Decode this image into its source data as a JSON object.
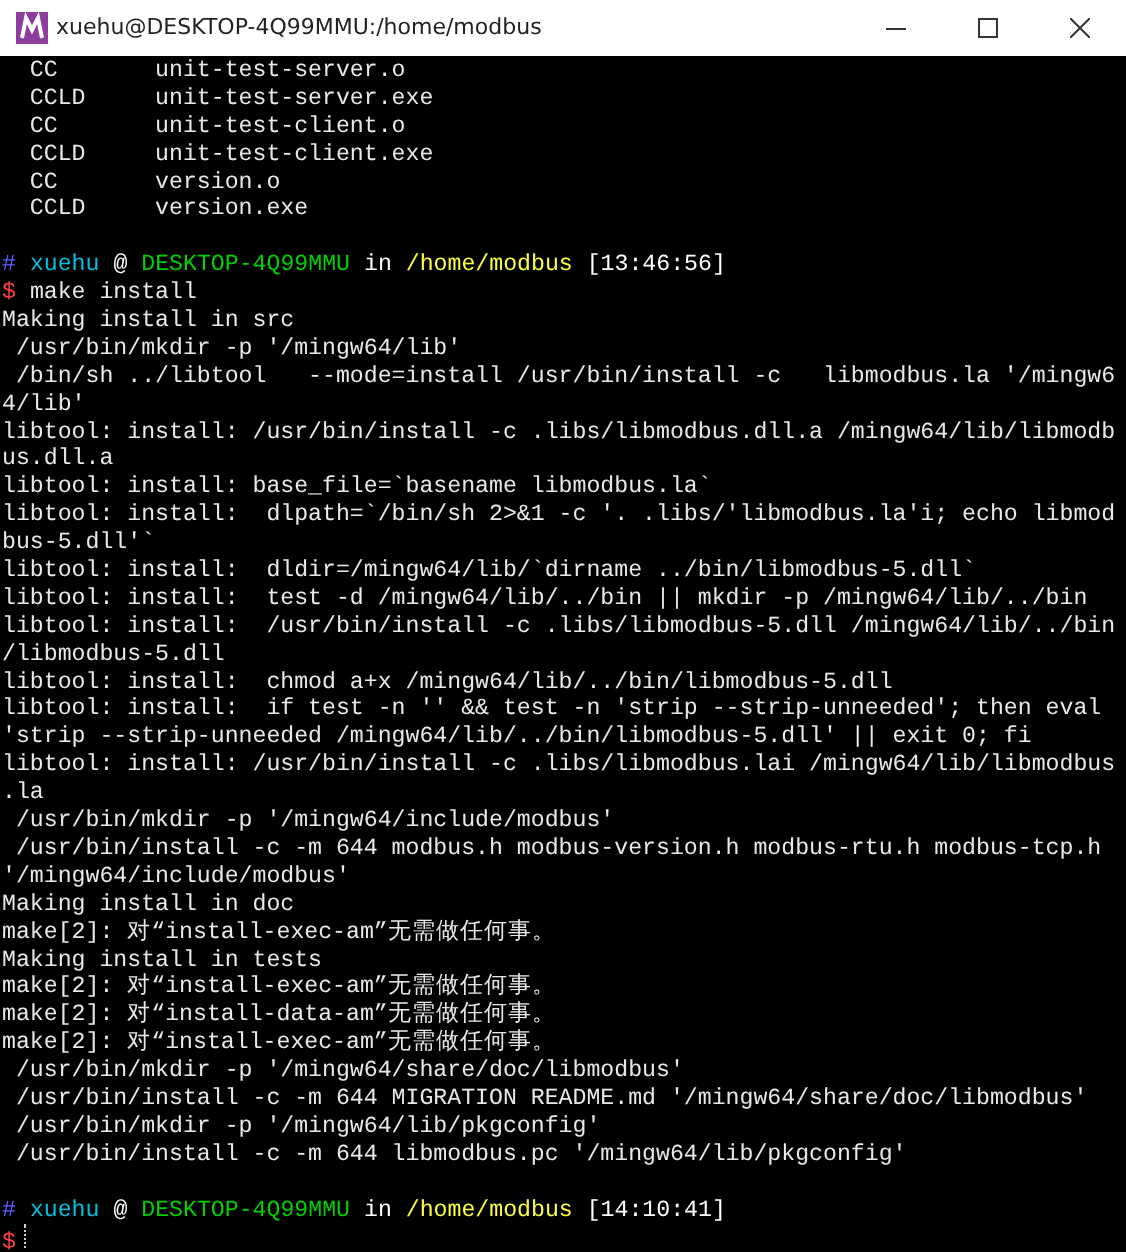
{
  "window": {
    "title": "xuehu@DESKTOP-4Q99MMU:/home/modbus"
  },
  "terminal": {
    "lines": [
      {
        "kind": "text",
        "text": "  CC       unit-test-server.o"
      },
      {
        "kind": "text",
        "text": "  CCLD     unit-test-server.exe"
      },
      {
        "kind": "text",
        "text": "  CC       unit-test-client.o"
      },
      {
        "kind": "text",
        "text": "  CCLD     unit-test-client.exe"
      },
      {
        "kind": "text",
        "text": "  CC       version.o"
      },
      {
        "kind": "text",
        "text": "  CCLD     version.exe"
      },
      {
        "kind": "blank"
      },
      {
        "kind": "prompt",
        "segments": [
          {
            "text": "#",
            "color": "#5f5fff"
          },
          {
            "text": "xuehu",
            "color": "#00c0e0"
          },
          {
            "text": "@",
            "color": "#ffffff"
          },
          {
            "text": "DESKTOP-4Q99MMU",
            "color": "#00d000"
          },
          {
            "text": "in",
            "color": "#ffffff"
          },
          {
            "text": "/home/modbus",
            "color": "#ffff40"
          },
          {
            "text": "[13:46:56]",
            "color": "#ffffff"
          }
        ]
      },
      {
        "kind": "command",
        "symbol": "$",
        "text": "make install"
      },
      {
        "kind": "text",
        "text": "Making install in src"
      },
      {
        "kind": "text",
        "text": " /usr/bin/mkdir -p '/mingw64/lib'"
      },
      {
        "kind": "text",
        "text": " /bin/sh ../libtool   --mode=install /usr/bin/install -c   libmodbus.la '/mingw6"
      },
      {
        "kind": "text",
        "text": "4/lib'"
      },
      {
        "kind": "text",
        "text": "libtool: install: /usr/bin/install -c .libs/libmodbus.dll.a /mingw64/lib/libmodb"
      },
      {
        "kind": "text",
        "text": "us.dll.a"
      },
      {
        "kind": "text",
        "text": "libtool: install: base_file=`basename libmodbus.la`"
      },
      {
        "kind": "text",
        "text": "libtool: install:  dlpath=`/bin/sh 2>&1 -c '. .libs/'libmodbus.la'i; echo libmod"
      },
      {
        "kind": "text",
        "text": "bus-5.dll'`"
      },
      {
        "kind": "text",
        "text": "libtool: install:  dldir=/mingw64/lib/`dirname ../bin/libmodbus-5.dll`"
      },
      {
        "kind": "text",
        "text": "libtool: install:  test -d /mingw64/lib/../bin || mkdir -p /mingw64/lib/../bin"
      },
      {
        "kind": "text",
        "text": "libtool: install:  /usr/bin/install -c .libs/libmodbus-5.dll /mingw64/lib/../bin"
      },
      {
        "kind": "text",
        "text": "/libmodbus-5.dll"
      },
      {
        "kind": "text",
        "text": "libtool: install:  chmod a+x /mingw64/lib/../bin/libmodbus-5.dll"
      },
      {
        "kind": "text",
        "text": "libtool: install:  if test -n '' && test -n 'strip --strip-unneeded'; then eval"
      },
      {
        "kind": "text",
        "text": "'strip --strip-unneeded /mingw64/lib/../bin/libmodbus-5.dll' || exit 0; fi"
      },
      {
        "kind": "text",
        "text": "libtool: install: /usr/bin/install -c .libs/libmodbus.lai /mingw64/lib/libmodbus"
      },
      {
        "kind": "text",
        "text": ".la"
      },
      {
        "kind": "text",
        "text": " /usr/bin/mkdir -p '/mingw64/include/modbus'"
      },
      {
        "kind": "text",
        "text": " /usr/bin/install -c -m 644 modbus.h modbus-version.h modbus-rtu.h modbus-tcp.h"
      },
      {
        "kind": "text",
        "text": "'/mingw64/include/modbus'"
      },
      {
        "kind": "text",
        "text": "Making install in doc"
      },
      {
        "kind": "text",
        "text": "make[2]: 对“install-exec-am”无需做任何事。"
      },
      {
        "kind": "text",
        "text": "Making install in tests"
      },
      {
        "kind": "text",
        "text": "make[2]: 对“install-exec-am”无需做任何事。"
      },
      {
        "kind": "text",
        "text": "make[2]: 对“install-data-am”无需做任何事。"
      },
      {
        "kind": "text",
        "text": "make[2]: 对“install-exec-am”无需做任何事。"
      },
      {
        "kind": "text",
        "text": " /usr/bin/mkdir -p '/mingw64/share/doc/libmodbus'"
      },
      {
        "kind": "text",
        "text": " /usr/bin/install -c -m 644 MIGRATION README.md '/mingw64/share/doc/libmodbus'"
      },
      {
        "kind": "text",
        "text": " /usr/bin/mkdir -p '/mingw64/lib/pkgconfig'"
      },
      {
        "kind": "text",
        "text": " /usr/bin/install -c -m 644 libmodbus.pc '/mingw64/lib/pkgconfig'"
      },
      {
        "kind": "blank"
      },
      {
        "kind": "prompt",
        "segments": [
          {
            "text": "#",
            "color": "#5f5fff"
          },
          {
            "text": "xuehu",
            "color": "#00c0e0"
          },
          {
            "text": "@",
            "color": "#ffffff"
          },
          {
            "text": "DESKTOP-4Q99MMU",
            "color": "#00d000"
          },
          {
            "text": "in",
            "color": "#ffffff"
          },
          {
            "text": "/home/modbus",
            "color": "#ffff40"
          },
          {
            "text": "[14:10:41]",
            "color": "#ffffff"
          }
        ]
      },
      {
        "kind": "cursor",
        "symbol": "$"
      }
    ]
  }
}
